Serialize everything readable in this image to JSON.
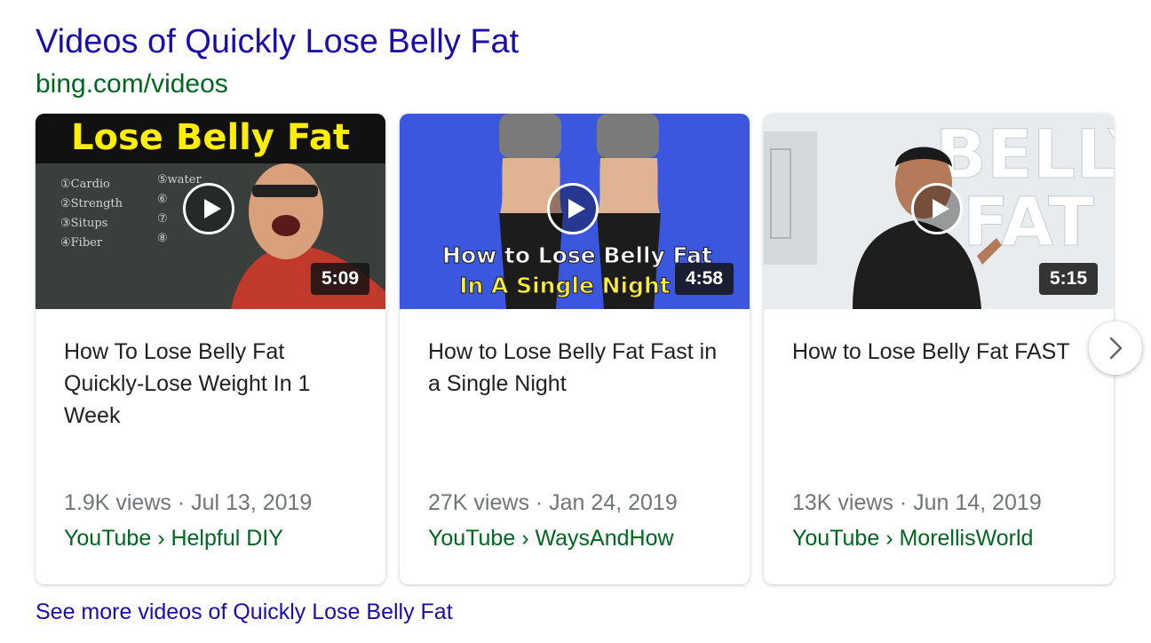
{
  "header": {
    "title": "Videos of Quickly Lose Belly Fat",
    "source": "bing.com/videos"
  },
  "cards": [
    {
      "title": "How To Lose Belly Fat Quickly-Lose Weight In 1 Week",
      "duration": "5:09",
      "views_date": "1.9K views · Jul 13, 2019",
      "channel": "YouTube › Helpful DIY",
      "thumb_text": "Lose Belly Fat",
      "board_text": [
        "①Cardio",
        "②Strength",
        "③Situps",
        "④Fiber",
        "⑤water",
        "⑥",
        "⑦",
        "⑧"
      ]
    },
    {
      "title": "How to Lose Belly Fat Fast in a Single Night",
      "duration": "4:58",
      "views_date": "27K views · Jan 24, 2019",
      "channel": "YouTube › WaysAndHow",
      "thumb_line1": "How to Lose Belly Fat",
      "thumb_line2": "In A Single Night"
    },
    {
      "title": "How to Lose Belly Fat FAST",
      "duration": "5:15",
      "views_date": "13K views · Jun 14, 2019",
      "channel": "YouTube › MorellisWorld",
      "thumb_line1": "BELLY",
      "thumb_line2": "FAT"
    }
  ],
  "icons": {
    "play": "play-icon",
    "next": "chevron-right-icon"
  },
  "more_link": "See more videos of Quickly Lose Belly Fat",
  "colors": {
    "link": "#1a0dab",
    "url_green": "#006621",
    "meta_gray": "#70757a",
    "thumb1_banner": "#ffee00",
    "thumb2_bg": "#3b57e0"
  }
}
